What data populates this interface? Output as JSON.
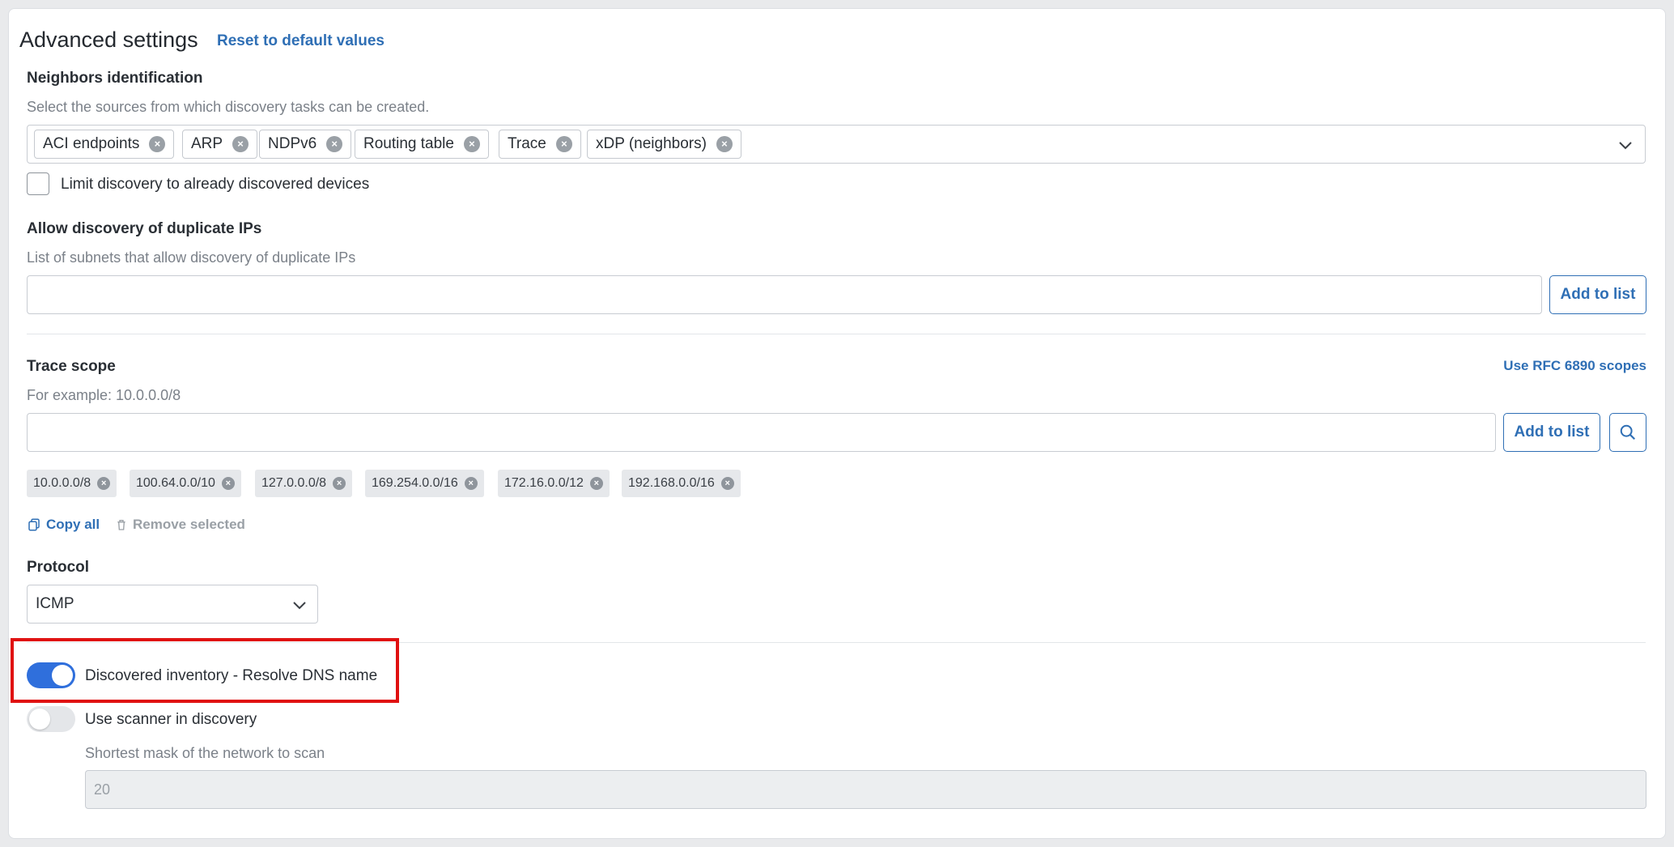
{
  "header": {
    "title": "Advanced settings",
    "reset_link": "Reset to default values"
  },
  "neighbors": {
    "label": "Neighbors identification",
    "hint": "Select the sources from which discovery tasks can be created.",
    "sources": [
      "ACI endpoints",
      "ARP",
      "NDPv6",
      "Routing table",
      "Trace",
      "xDP (neighbors)"
    ],
    "limit_checkbox_label": "Limit discovery to already discovered devices",
    "limit_checked": false
  },
  "duplicate_ips": {
    "label": "Allow discovery of duplicate IPs",
    "hint": "List of subnets that allow discovery of duplicate IPs",
    "input_value": "",
    "add_button": "Add to list"
  },
  "trace_scope": {
    "label": "Trace scope",
    "rfc_link": "Use RFC 6890 scopes",
    "hint": "For example: 10.0.0.0/8",
    "input_value": "",
    "add_button": "Add to list",
    "scopes": [
      "10.0.0.0/8",
      "100.64.0.0/10",
      "127.0.0.0/8",
      "169.254.0.0/16",
      "172.16.0.0/12",
      "192.168.0.0/16"
    ],
    "copy_all": "Copy all",
    "remove_selected": "Remove selected"
  },
  "protocol": {
    "label": "Protocol",
    "selected": "ICMP"
  },
  "toggles": {
    "resolve_dns_label": "Discovered inventory - Resolve DNS name",
    "resolve_dns_on": true,
    "scanner_label": "Use scanner in discovery",
    "scanner_on": false
  },
  "scanner": {
    "mask_label": "Shortest mask of the network to scan",
    "mask_value": "20"
  },
  "colors": {
    "accent": "#2f6fb5",
    "toggle_on": "#2f6fdc",
    "toggle_off": "#e4e6e9",
    "highlight": "#e01010"
  }
}
